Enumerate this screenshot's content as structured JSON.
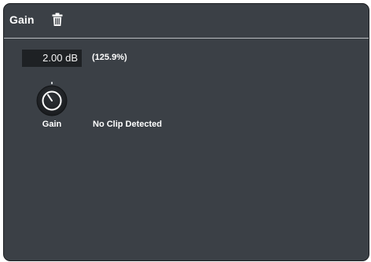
{
  "panel": {
    "title": "Gain",
    "delete_icon": "trash-icon"
  },
  "gain": {
    "value": "2.00 dB",
    "percent": "(125.9%)",
    "knob_label": "Gain",
    "knob_level": 0.5
  },
  "status": {
    "clip_text": "No Clip Detected"
  },
  "colors": {
    "panel_bg": "#3b4046",
    "field_bg": "#1e2124",
    "divider": "#b9bcc0",
    "text": "#ffffff"
  }
}
